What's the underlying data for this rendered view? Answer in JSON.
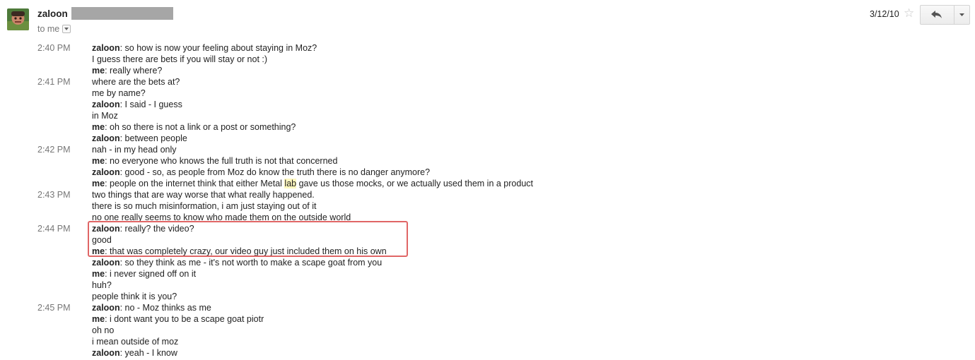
{
  "message": {
    "sender": "zaloon",
    "recipient_label": "to me",
    "date": "3/12/10",
    "star_icon": "star-outline-icon",
    "reply_icon": "reply-arrow-icon",
    "more_icon": "chevron-down-icon"
  },
  "chat": [
    {
      "time": "2:40 PM",
      "speaker": "zaloon",
      "text": "so how is now your feeling about staying in Moz?"
    },
    {
      "time": "",
      "speaker": "",
      "text": "I guess there are bets if you will stay or not :)"
    },
    {
      "time": "",
      "speaker": "me",
      "text": "really where?"
    },
    {
      "time": "2:41 PM",
      "speaker": "",
      "text": "where are the bets at?"
    },
    {
      "time": "",
      "speaker": "",
      "text": "me by name?"
    },
    {
      "time": "",
      "speaker": "zaloon",
      "text": "I said - I guess"
    },
    {
      "time": "",
      "speaker": "",
      "text": "in Moz"
    },
    {
      "time": "",
      "speaker": "me",
      "text": "oh so there is not a link or a post or something?"
    },
    {
      "time": "",
      "speaker": "zaloon",
      "text": "between people"
    },
    {
      "time": "2:42 PM",
      "speaker": "",
      "text": "nah - in my head only"
    },
    {
      "time": "",
      "speaker": "me",
      "text": "no everyone who knows the full truth is not that concerned"
    },
    {
      "time": "",
      "speaker": "zaloon",
      "text": "good - so, as people from Moz do know the truth there is no danger anymore?"
    },
    {
      "time": "",
      "speaker": "me",
      "text_before": "people on the internet think that either Metal ",
      "highlight": "lab",
      "text_after": " gave us those mocks, or we actually used them in a product"
    },
    {
      "time": "2:43 PM",
      "speaker": "",
      "text": "two things that are way worse that what really happened."
    },
    {
      "time": "",
      "speaker": "",
      "text": "there is so much misinformation, i am just staying out of it"
    },
    {
      "time": "",
      "speaker": "",
      "text": "no one really seems to know who made them on the outside world"
    },
    {
      "time": "2:44 PM",
      "speaker": "zaloon",
      "text": "really? the video?"
    },
    {
      "time": "",
      "speaker": "",
      "text": "good"
    },
    {
      "time": "",
      "speaker": "me",
      "text": "that was completely crazy, our video guy just included them on his own"
    },
    {
      "time": "",
      "speaker": "zaloon",
      "text": "so they think as me - it's not worth to make a scape goat from you"
    },
    {
      "time": "",
      "speaker": "me",
      "text": "i never signed off on it"
    },
    {
      "time": "",
      "speaker": "",
      "text": "huh?"
    },
    {
      "time": "",
      "speaker": "",
      "text": "people think it is you?"
    },
    {
      "time": "2:45 PM",
      "speaker": "zaloon",
      "text": "no - Moz thinks as me"
    },
    {
      "time": "",
      "speaker": "me",
      "text": "i dont want you to be a scape goat piotr"
    },
    {
      "time": "",
      "speaker": "",
      "text": "oh no"
    },
    {
      "time": "",
      "speaker": "",
      "text": "i mean outside of moz"
    },
    {
      "time": "",
      "speaker": "zaloon",
      "text": "yeah - I know"
    }
  ]
}
